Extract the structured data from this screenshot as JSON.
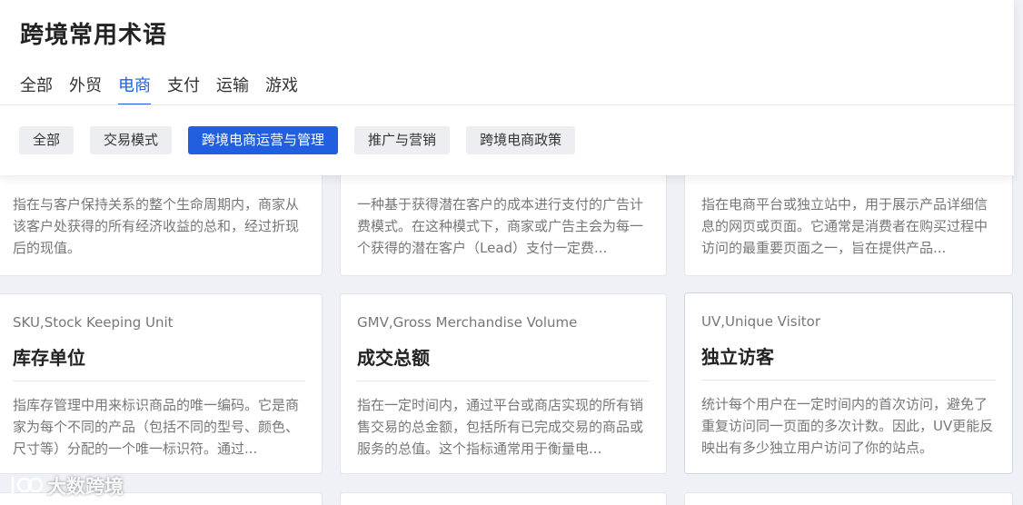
{
  "page": {
    "title": "跨境常用术语"
  },
  "tabs": [
    {
      "label": "全部"
    },
    {
      "label": "外贸"
    },
    {
      "label": "电商"
    },
    {
      "label": "支付"
    },
    {
      "label": "运输"
    },
    {
      "label": "游戏"
    }
  ],
  "active_tab": "电商",
  "chips": [
    {
      "label": "全部"
    },
    {
      "label": "交易模式"
    },
    {
      "label": "跨境电商运营与管理"
    },
    {
      "label": "推广与营销"
    },
    {
      "label": "跨境电商政策"
    }
  ],
  "active_chip": "跨境电商运营与管理",
  "cards_top": [
    {
      "desc": "指在与客户保持关系的整个生命周期内，商家从该客户处获得的所有经济收益的总和，经过折现后的现值。"
    },
    {
      "desc": "一种基于获得潜在客户的成本进行支付的广告计费模式。在这种模式下，商家或广告主会为每一个获得的潜在客户（Lead）支付一定费..."
    },
    {
      "desc": "指在电商平台或独立站中，用于展示产品详细信息的网页或页面。它通常是消费者在购买过程中访问的最重要页面之一，旨在提供产品..."
    }
  ],
  "cards": [
    {
      "sub": "SKU,Stock Keeping Unit",
      "name": "库存单位",
      "desc": "指库存管理中用来标识商品的唯一编码。它是商家为每个不同的产品（包括不同的型号、颜色、尺寸等）分配的一个唯一标识符。通过..."
    },
    {
      "sub": "GMV,Gross Merchandise Volume",
      "name": "成交总额",
      "desc": "指在一定时间内，通过平台或商店实现的所有销售交易的总金额，包括所有已完成交易的商品或服务的总值。这个指标通常用于衡量电..."
    },
    {
      "sub": "UV,Unique Visitor",
      "name": "独立访客",
      "desc": "统计每个用户在一定时间内的首次访问，避免了重复访问同一页面的多次计数。因此，UV更能反映出有多少独立用户访问了你的站点。"
    }
  ],
  "watermark": {
    "text": "大数跨境"
  },
  "colors": {
    "accent": "#1f5fe0",
    "background": "#eef1f6"
  }
}
